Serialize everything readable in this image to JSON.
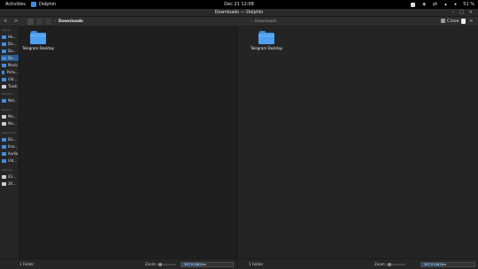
{
  "system_bar": {
    "activities": "Activities",
    "app_name": "Dolphin",
    "clock": "Dec 21  12:08",
    "lang": "pt",
    "battery": "51 %"
  },
  "window": {
    "title": "Downloads — Dolphin",
    "minimize": "–",
    "maximize": "□",
    "close": "×"
  },
  "toolbar": {
    "back": "<",
    "forward": ">",
    "left_breadcrumb": "Downloads",
    "right_breadcrumb": "Downloads",
    "close_split": "Close"
  },
  "sidebar": {
    "sections": [
      {
        "header": "Places",
        "items": [
          "Ho...",
          "De...",
          "Do...",
          "Do...",
          "Music",
          "Pictu...",
          "Vid...",
          "Trash"
        ]
      },
      {
        "header": "Remote",
        "items": [
          "Net..."
        ]
      },
      {
        "header": "Recent",
        "items": [
          "Mo...",
          "Mo..."
        ]
      },
      {
        "header": "Search For",
        "items": [
          "Do...",
          "Ima...",
          "Audio",
          "Vid..."
        ]
      },
      {
        "header": "Devices",
        "items": [
          "43...",
          "30..."
        ]
      }
    ]
  },
  "left_pane": {
    "files": [
      {
        "name": "Telegram Desktop"
      }
    ]
  },
  "right_pane": {
    "files": [
      {
        "name": "Telegram Desktop"
      }
    ]
  },
  "status_left": {
    "count": "1 Folder",
    "zoom_label": "Zoom:",
    "free": "397,9 GiB free",
    "used_fraction": 0.4
  },
  "status_right": {
    "count": "1 Folder",
    "zoom_label": "Zoom:",
    "free": "397,9 GiB free",
    "used_fraction": 0.4
  }
}
